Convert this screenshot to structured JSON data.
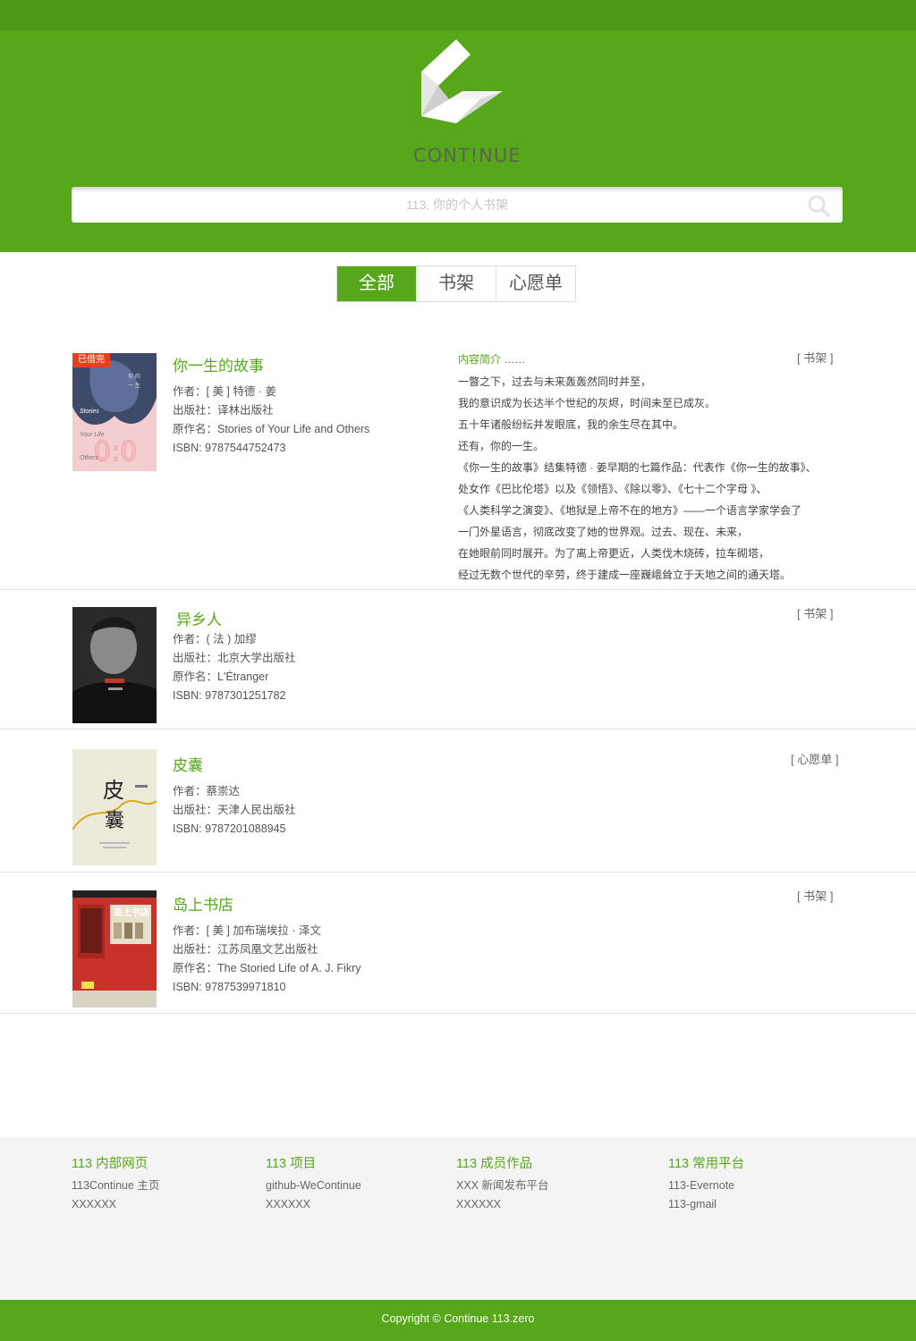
{
  "header": {
    "logo_text": "CONT!NUE",
    "search_placeholder": "113, 你的个人书架"
  },
  "tabs": [
    {
      "label": "全部",
      "active": true
    },
    {
      "label": "书架",
      "active": false
    },
    {
      "label": "心愿单",
      "active": false
    }
  ],
  "books": [
    {
      "title": "你一生的故事",
      "author": "作者：[ 美 ] 特德 · 姜",
      "publisher": "出版社：译林出版社",
      "original": "原作名：Stories of Your Life and Others",
      "isbn": "ISBN: 9787544752473",
      "tag": "[ 书架 ]",
      "badge": "已借完",
      "cover_text": [
        "Stories",
        "Your Life",
        "Others"
      ],
      "desc_label": "内容简介",
      "desc_dots": "……",
      "desc": [
        "一瞥之下，过去与未来轰轰然同时并至，",
        "我的意识成为长达半个世纪的灰烬，时间未至已成灰。",
        "五十年诸般纷纭并发眼底，我的余生尽在其中。",
        "还有，你的一生。",
        "《你一生的故事》结集特德 · 姜早期的七篇作品：代表作《你一生的故事》、",
        "处女作《巴比伦塔》以及《领悟》、《除以零》、《七十二个字母 》、",
        "《人类科学之演变》、《地狱是上帝不在的地方》——一个语言学家学会了",
        "一门外星语言，彻底改变了她的世界观。过去、现在、未来，",
        "在她眼前同时展开。为了离上帝更近，人类伐木烧砖，拉车砌塔，",
        "经过无数个世代的辛劳，终于建成一座巍峨耸立于天地之间的通天塔。"
      ]
    },
    {
      "title": "异乡人",
      "author": "作者：( 法 ) 加缪",
      "publisher": "出版社：北京大学出版社",
      "original": "原作名：L'Étranger",
      "isbn": "ISBN: 9787301251782",
      "tag": "[ 书架 ]"
    },
    {
      "title": "皮囊",
      "author": "作者：蔡崇达",
      "publisher": "出版社：天津人民出版社",
      "isbn": "ISBN: 9787201088945",
      "tag": "[ 心愿单 ]",
      "cover_text": [
        "皮",
        "囊"
      ]
    },
    {
      "title": "岛上书店",
      "author": "作者：[ 美 ] 加布瑞埃拉 · 泽文",
      "publisher": "出版社：江苏凤凰文艺出版社",
      "original": "原作名：The Storied Life of A. J. Fikry",
      "isbn": "ISBN: 9787539971810",
      "tag": "[ 书架 ]",
      "cover_text": [
        "岛上书店"
      ]
    }
  ],
  "footer": {
    "columns": [
      {
        "title": "113 内部网页",
        "links": [
          "113Continue 主页",
          "XXXXXX"
        ]
      },
      {
        "title": "113 项目",
        "links": [
          "github-WeContinue",
          "XXXXXX"
        ]
      },
      {
        "title": "113 成员作品",
        "links": [
          "XXX 新闻发布平台",
          "XXXXXX"
        ]
      },
      {
        "title": "113 常用平台",
        "links": [
          "113-Evernote",
          "113-gmail"
        ]
      }
    ],
    "copyright": "Copyright © Continue 113.zero"
  },
  "colors": {
    "brand_green": "#56a81a",
    "topbar_green": "#4e9a18",
    "badge_red": "#e8401c"
  },
  "icons": [
    "continue-logo",
    "search-icon"
  ]
}
